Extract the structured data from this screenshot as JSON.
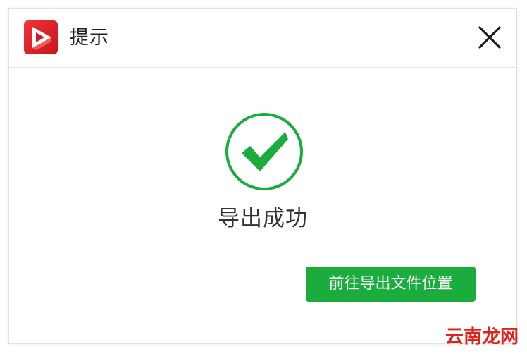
{
  "dialog": {
    "title": "提示",
    "icons": {
      "app_logo": "app-logo-icon",
      "close": "close-icon",
      "success": "check-circle-icon"
    },
    "message": "导出成功",
    "button_label": "前往导出文件位置"
  },
  "watermark": {
    "text": "云南龙网"
  },
  "colors": {
    "success_green": "#1aad3e",
    "logo_red": "#e3242b",
    "watermark_red": "#e0221b"
  }
}
